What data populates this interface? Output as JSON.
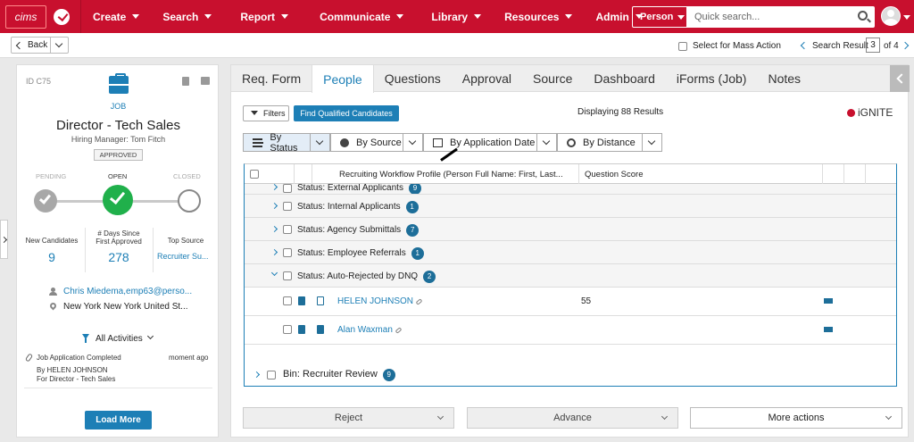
{
  "nav": {
    "logo": "cims",
    "items": [
      {
        "label": "Create"
      },
      {
        "label": "Search"
      },
      {
        "label": "Report"
      },
      {
        "label": "Communicate"
      },
      {
        "label": "Library"
      },
      {
        "label": "Resources"
      },
      {
        "label": "Admin"
      }
    ],
    "search_type": "Person",
    "search_placeholder": "Quick search..."
  },
  "subbar": {
    "back": "Back",
    "mass_action": "Select for Mass Action",
    "search_result_label": "Search Result",
    "search_result_num": "3",
    "search_result_of": "of 4"
  },
  "job": {
    "id": "ID C75",
    "type": "JOB",
    "title": "Director - Tech Sales",
    "hiring_manager": "Hiring Manager: Tom Fitch",
    "approval": "APPROVED",
    "stages": {
      "pending": "PENDING",
      "open": "OPEN",
      "closed": "CLOSED"
    },
    "metrics": {
      "new_candidates_label": "New Candidates",
      "new_candidates": "9",
      "days_label_1": "# Days Since",
      "days_label_2": "First Approved",
      "days": "278",
      "top_source_label": "Top Source",
      "top_source": "Recruiter Su..."
    },
    "contact": "Chris Miedema,emp63@perso...",
    "location": "New York New York United St...",
    "all_activities": "All Activities",
    "activity": {
      "title": "Job Application Completed",
      "time": "moment ago",
      "by": "By HELEN JOHNSON",
      "for": "For Director - Tech Sales"
    },
    "load_more": "Load More"
  },
  "tabs": [
    {
      "label": "Req. Form"
    },
    {
      "label": "People"
    },
    {
      "label": "Questions"
    },
    {
      "label": "Approval"
    },
    {
      "label": "Source"
    },
    {
      "label": "Dashboard"
    },
    {
      "label": "iForms (Job)"
    },
    {
      "label": "Notes"
    }
  ],
  "people": {
    "filters": "Filters",
    "find_qualified": "Find Qualified Candidates",
    "results": "Displaying 88 Results",
    "brand": "iGNITE",
    "groupby": [
      "By Status",
      "By Source",
      "By Application Date",
      "By Distance"
    ],
    "columns": {
      "profile": "Recruiting Workflow Profile (Person Full Name: First, Last...",
      "score": "Question Score"
    },
    "groups": [
      {
        "label": "Status: External Applicants",
        "count": "9"
      },
      {
        "label": "Status: Internal Applicants",
        "count": "1"
      },
      {
        "label": "Status: Agency Submittals",
        "count": "7"
      },
      {
        "label": "Status: Employee Referrals",
        "count": "1"
      },
      {
        "label": "Status: Auto-Rejected by DNQ",
        "count": "2"
      }
    ],
    "candidates": [
      {
        "name": "HELEN JOHNSON",
        "score": "55"
      },
      {
        "name": "Alan Waxman",
        "score": ""
      }
    ],
    "bin": {
      "label": "Bin: Recruiter Review",
      "count": "9"
    }
  },
  "actions": {
    "reject": "Reject",
    "advance": "Advance",
    "more": "More actions"
  }
}
